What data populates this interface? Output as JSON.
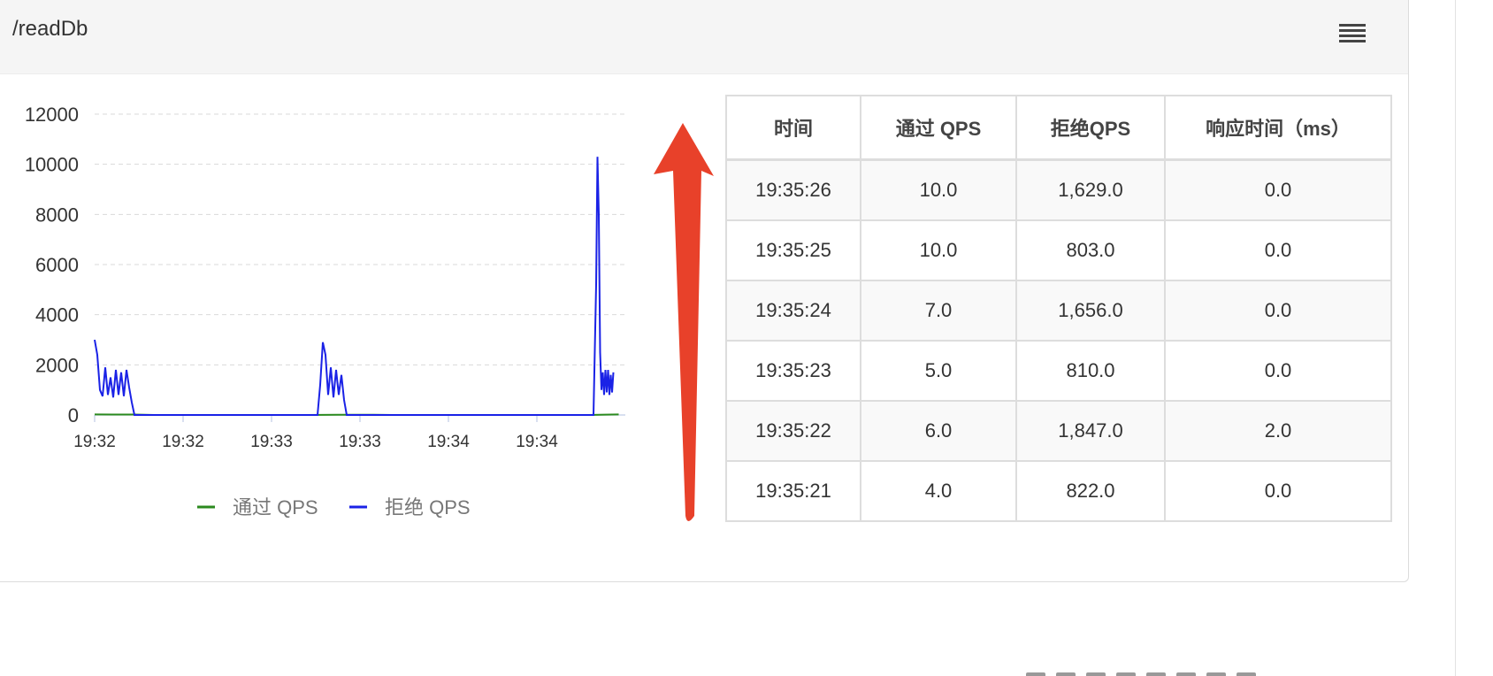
{
  "panel": {
    "title": "/readDb",
    "menu_icon": "hamburger-menu-icon"
  },
  "chart_data": {
    "type": "line",
    "x_ticks": [
      "19:32",
      "19:32",
      "19:33",
      "19:33",
      "19:34",
      "19:34"
    ],
    "y_ticks": [
      "0",
      "2000",
      "4000",
      "6000",
      "8000",
      "10000",
      "12000"
    ],
    "ylim": [
      0,
      12000
    ],
    "grid": true,
    "legend_position": "bottom",
    "colors": {
      "pass": "#2b8a1e",
      "block": "#1a22e6"
    },
    "series": [
      {
        "name": "通过 QPS",
        "points": [
          [
            0,
            20
          ],
          [
            30,
            18
          ],
          [
            45,
            0
          ],
          [
            100,
            0
          ],
          [
            160,
            0
          ],
          [
            186,
            12
          ],
          [
            210,
            10
          ],
          [
            225,
            0
          ],
          [
            300,
            0
          ],
          [
            372,
            0
          ],
          [
            385,
            15
          ],
          [
            395,
            20
          ]
        ]
      },
      {
        "name": "拒绝 QPS",
        "points": [
          [
            0,
            3000
          ],
          [
            2,
            2400
          ],
          [
            4,
            1000
          ],
          [
            6,
            750
          ],
          [
            8,
            1900
          ],
          [
            10,
            800
          ],
          [
            12,
            1500
          ],
          [
            14,
            700
          ],
          [
            16,
            1800
          ],
          [
            18,
            800
          ],
          [
            20,
            1700
          ],
          [
            22,
            750
          ],
          [
            24,
            1800
          ],
          [
            26,
            1100
          ],
          [
            28,
            500
          ],
          [
            30,
            0
          ],
          [
            100,
            0
          ],
          [
            168,
            0
          ],
          [
            170,
            1200
          ],
          [
            172,
            2900
          ],
          [
            174,
            2400
          ],
          [
            176,
            800
          ],
          [
            178,
            1900
          ],
          [
            180,
            700
          ],
          [
            182,
            1800
          ],
          [
            184,
            800
          ],
          [
            186,
            1600
          ],
          [
            188,
            600
          ],
          [
            190,
            0
          ],
          [
            300,
            0
          ],
          [
            340,
            0
          ],
          [
            376,
            0
          ],
          [
            378,
            5200
          ],
          [
            379,
            10300
          ],
          [
            380,
            8000
          ],
          [
            381,
            2500
          ],
          [
            382,
            1000
          ],
          [
            383,
            1700
          ],
          [
            384,
            800
          ],
          [
            385,
            1800
          ],
          [
            386,
            900
          ],
          [
            387,
            1800
          ],
          [
            388,
            800
          ],
          [
            389,
            1600
          ],
          [
            390,
            900
          ],
          [
            391,
            1700
          ]
        ]
      }
    ]
  },
  "arrow": {
    "color": "#e8412a",
    "icon": "red-up-arrow-annotation"
  },
  "table": {
    "headers": [
      "时间",
      "通过 QPS",
      "拒绝QPS",
      "响应时间（ms）"
    ],
    "rows": [
      [
        "19:35:26",
        "10.0",
        "1,629.0",
        "0.0"
      ],
      [
        "19:35:25",
        "10.0",
        "803.0",
        "0.0"
      ],
      [
        "19:35:24",
        "7.0",
        "1,656.0",
        "0.0"
      ],
      [
        "19:35:23",
        "5.0",
        "810.0",
        "0.0"
      ],
      [
        "19:35:22",
        "6.0",
        "1,847.0",
        "2.0"
      ],
      [
        "19:35:21",
        "4.0",
        "822.0",
        "0.0"
      ]
    ]
  }
}
